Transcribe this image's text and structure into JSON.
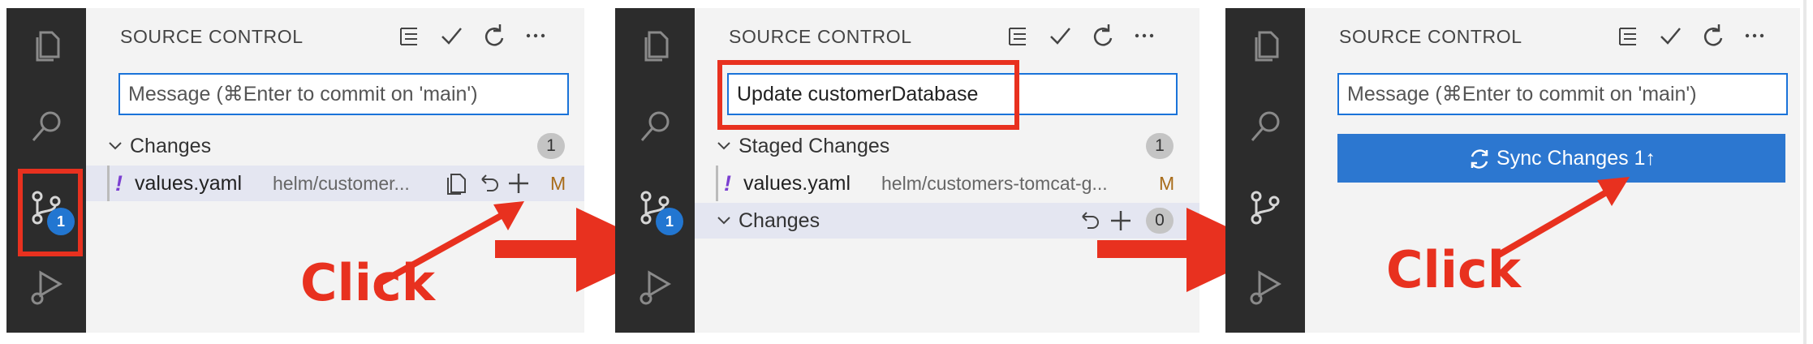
{
  "colors": {
    "activity_bar": "#2c2c2c",
    "sidebar": "#f3f3f3",
    "accent": "#2c77d0",
    "annotation_red": "#e8311f",
    "modified": "#a86c1a"
  },
  "panel1": {
    "title": "SOURCE CONTROL",
    "toolbar_icons": [
      "tree-view-icon",
      "checkmark-icon",
      "refresh-icon",
      "more-icon"
    ],
    "scm_badge": "1",
    "message_placeholder": "Message (⌘Enter to commit on 'main')",
    "changes": {
      "label": "Changes",
      "count": "1"
    },
    "file": {
      "marker": "!",
      "name": "values.yaml",
      "path": "helm/customer...",
      "status": "M"
    },
    "annotation": "Click"
  },
  "panel2": {
    "title": "SOURCE CONTROL",
    "scm_badge": "1",
    "message_value": "Update customerDatabase",
    "staged": {
      "label": "Staged Changes",
      "count": "1"
    },
    "file": {
      "marker": "!",
      "name": "values.yaml",
      "path": "helm/customers-tomcat-g...",
      "status": "M"
    },
    "changes": {
      "label": "Changes",
      "count": "0"
    }
  },
  "panel3": {
    "title": "SOURCE CONTROL",
    "message_placeholder": "Message (⌘Enter to commit on 'main')",
    "sync_label": "Sync Changes 1↑",
    "annotation": "Click"
  }
}
